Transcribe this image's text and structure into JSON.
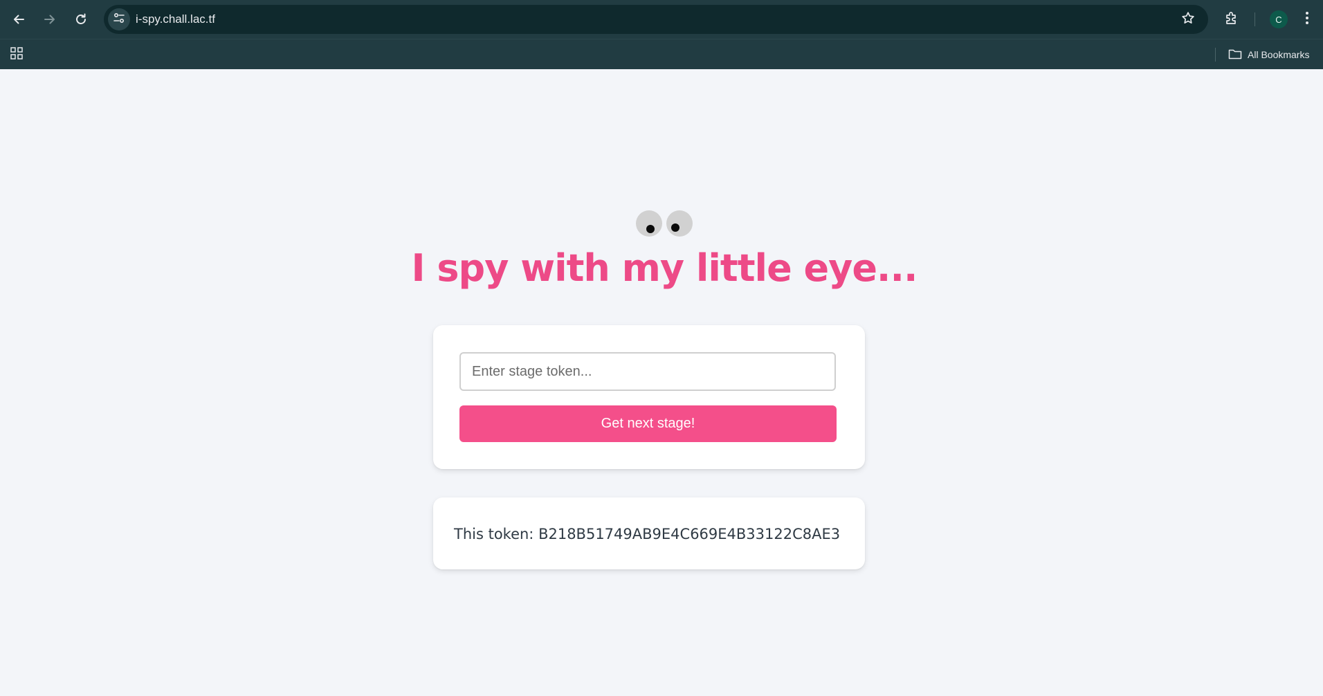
{
  "browser": {
    "url": "i-spy.chall.lac.tf",
    "profile_initial": "C",
    "bookmarks_label": "All Bookmarks",
    "icons": {
      "back": "arrow-left-icon",
      "forward": "arrow-right-icon",
      "reload": "reload-icon",
      "site_info": "tune-icon",
      "bookmark_star": "star-icon",
      "extensions": "puzzle-icon",
      "menu": "kebab-menu-icon",
      "apps": "grid-icon",
      "folder": "folder-icon"
    },
    "colors": {
      "toolbar": "#213c42",
      "omnibox": "#0f292d",
      "avatar": "#0d5a4b"
    }
  },
  "page": {
    "title": "I spy with my little eye...",
    "form": {
      "input_placeholder": "Enter stage token...",
      "input_value": "",
      "submit_label": "Get next stage!"
    },
    "token_display": "This token: B218B51749AB9E4C669E4B33122C8AE3",
    "colors": {
      "background": "#f3f5f9",
      "title": "#ed4a87",
      "button": "#f44f8a",
      "card": "#ffffff"
    },
    "icons": {
      "eyes": "googly-eyes-icon"
    }
  }
}
